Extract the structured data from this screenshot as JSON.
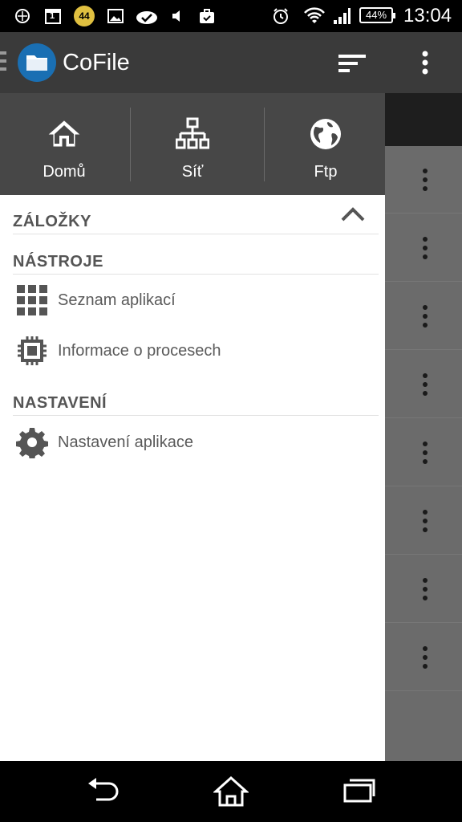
{
  "status_bar": {
    "battery": "44%",
    "time": "13:04",
    "badge_count": "44",
    "calendar_day": "1",
    "icons": [
      "app-notification-icon",
      "calendar-icon",
      "sync-badge-icon",
      "image-icon",
      "done-icon",
      "volume-icon",
      "briefcase-icon",
      "alarm-icon",
      "wifi-icon",
      "signal-icon",
      "battery-icon"
    ]
  },
  "app_bar": {
    "title": "CoFile"
  },
  "drawer": {
    "nav": [
      {
        "label": "Domů",
        "icon": "home-icon"
      },
      {
        "label": "Síť",
        "icon": "network-icon"
      },
      {
        "label": "Ftp",
        "icon": "globe-icon"
      }
    ],
    "sections": {
      "bookmarks": {
        "title": "ZÁLOŽKY"
      },
      "tools": {
        "title": "NÁSTROJE",
        "items": [
          {
            "label": "Seznam aplikací",
            "icon": "app-grid-icon"
          },
          {
            "label": "Informace o procesech",
            "icon": "chip-icon"
          }
        ]
      },
      "settings": {
        "title": "NASTAVENÍ",
        "items": [
          {
            "label": "Nastavení aplikace",
            "icon": "gear-icon"
          }
        ]
      }
    }
  },
  "colors": {
    "app_bar": "#3a3a3a",
    "drawer_header": "#474747",
    "logo": "#1a6fb3"
  }
}
